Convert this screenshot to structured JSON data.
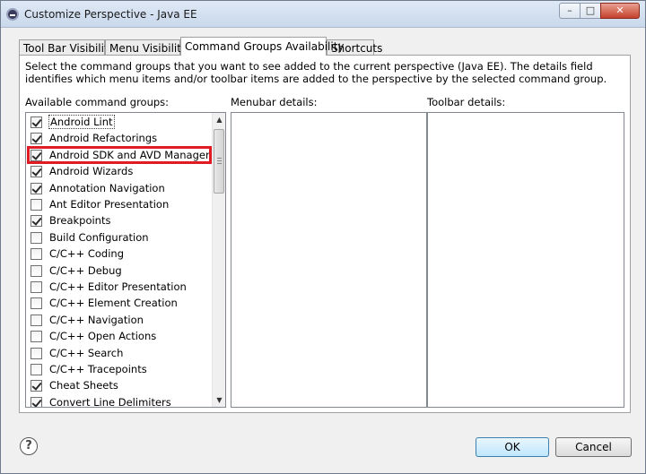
{
  "window": {
    "title": "Customize Perspective - Java EE",
    "min_glyph": "–",
    "max_glyph": "□",
    "close_glyph": "✕"
  },
  "tabs": [
    {
      "label": "Tool Bar Visibility"
    },
    {
      "label": "Menu Visibility"
    },
    {
      "label": "Command Groups Availability"
    },
    {
      "label": "Shortcuts"
    }
  ],
  "active_tab": "Command Groups Availability",
  "description": "Select the command groups that you want to see added to the current perspective (Java EE).  The details field identifies which menu items and/or toolbar items are added to the perspective by the selected command group.",
  "labels": {
    "available": "Available command groups:",
    "menubar": "Menubar details:",
    "toolbar": "Toolbar details:"
  },
  "command_groups": [
    {
      "label": "Android Lint",
      "checked": true
    },
    {
      "label": "Android Refactorings",
      "checked": true
    },
    {
      "label": "Android SDK and AVD Manager",
      "checked": true,
      "highlighted": true
    },
    {
      "label": "Android Wizards",
      "checked": true
    },
    {
      "label": "Annotation Navigation",
      "checked": true
    },
    {
      "label": "Ant Editor Presentation",
      "checked": false
    },
    {
      "label": "Breakpoints",
      "checked": true
    },
    {
      "label": "Build Configuration",
      "checked": false
    },
    {
      "label": "C/C++ Coding",
      "checked": false
    },
    {
      "label": "C/C++ Debug",
      "checked": false
    },
    {
      "label": "C/C++ Editor Presentation",
      "checked": false
    },
    {
      "label": "C/C++ Element Creation",
      "checked": false
    },
    {
      "label": "C/C++ Navigation",
      "checked": false
    },
    {
      "label": "C/C++ Open Actions",
      "checked": false
    },
    {
      "label": "C/C++ Search",
      "checked": false
    },
    {
      "label": "C/C++ Tracepoints",
      "checked": false
    },
    {
      "label": "Cheat Sheets",
      "checked": true
    },
    {
      "label": "Convert Line Delimiters",
      "checked": true
    }
  ],
  "focused_item": "Android Lint",
  "scroll": {
    "up_glyph": "▲",
    "down_glyph": "▼"
  },
  "help_glyph": "?",
  "buttons": {
    "ok": "OK",
    "cancel": "Cancel"
  },
  "colors": {
    "highlight": "#e01b24",
    "ok_button": "#bee6fd"
  }
}
